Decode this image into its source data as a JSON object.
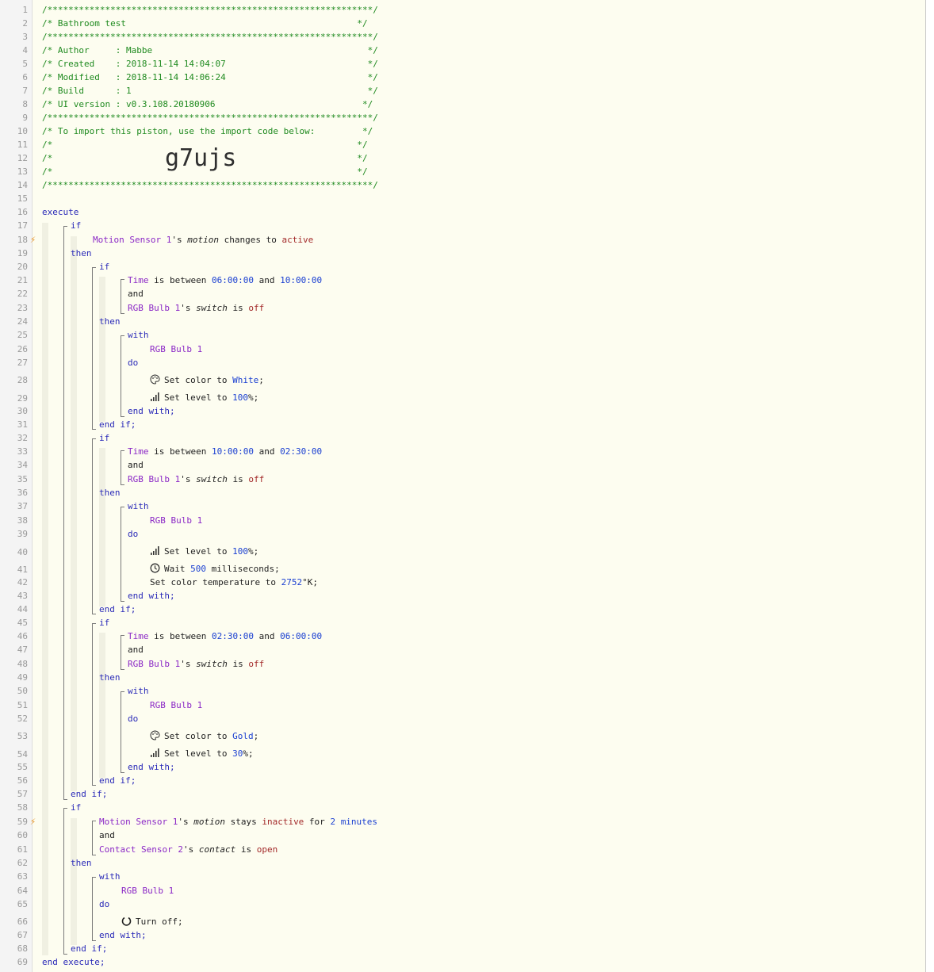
{
  "header": {
    "rule": "/**************************************************************/",
    "title_line": "/* Bathroom test                                            */",
    "author": "/* Author     : Mabbe                                         */",
    "created": "/* Created    : 2018-11-14 14:04:07                           */",
    "modified": "/* Modified   : 2018-11-14 14:06:24                           */",
    "build": "/* Build      : 1                                             */",
    "ui_version": "/* UI version : v0.3.108.20180906                            */",
    "import_note": "/* To import this piston, use the import code below:         */",
    "blank_open": "/*                                                          */",
    "import_code": "g7ujs"
  },
  "keywords": {
    "execute": "execute",
    "end_execute": "end execute;",
    "if": "if",
    "then": "then",
    "and": "and",
    "with": "with",
    "do": "do",
    "end_with": "end with;",
    "end_if": "end if;",
    "is_between": " is between ",
    "and_inline": " and ",
    "s_switch": "'s ",
    "is": " is ",
    "changes_to": " changes to ",
    "stays": " stays ",
    "for": " for "
  },
  "devices": {
    "motion1": "Motion Sensor 1",
    "bulb1": "RGB Bulb 1",
    "contact2": "Contact Sensor 2",
    "time": "Time"
  },
  "attrs": {
    "motion": "motion",
    "switch": "switch",
    "contact": "contact"
  },
  "states": {
    "active": "active",
    "off": "off",
    "inactive": "inactive",
    "open": "open"
  },
  "times": {
    "t0600": "06:00:00",
    "t1000": "10:00:00",
    "t0230": "02:30:00"
  },
  "actions": {
    "set_color_white_pre": "Set color to ",
    "white": "White",
    "gold": "Gold",
    "set_level_pre": "Set level to ",
    "lvl100": "100",
    "lvl30": "30",
    "pct": "%;",
    "semi": ";",
    "wait_pre": "Wait ",
    "wait_ms": "500",
    "wait_post": " milliseconds;",
    "ct_pre": "Set color temperature to ",
    "ct_val": "2752",
    "ct_post": "°K;",
    "turn_off": "Turn off;"
  },
  "misc": {
    "two": "2",
    "minutes": "minutes"
  },
  "line_numbers": [
    "1",
    "2",
    "3",
    "4",
    "5",
    "6",
    "7",
    "8",
    "9",
    "10",
    "11",
    "12",
    "13",
    "14",
    "15",
    "16",
    "17",
    "18",
    "19",
    "20",
    "21",
    "22",
    "23",
    "24",
    "25",
    "26",
    "27",
    "28",
    "29",
    "30",
    "31",
    "32",
    "33",
    "34",
    "35",
    "36",
    "37",
    "38",
    "39",
    "40",
    "41",
    "42",
    "43",
    "44",
    "45",
    "46",
    "47",
    "48",
    "49",
    "50",
    "51",
    "52",
    "53",
    "54",
    "55",
    "56",
    "57",
    "58",
    "59",
    "60",
    "61",
    "62",
    "63",
    "64",
    "65",
    "66",
    "67",
    "68",
    "69"
  ],
  "colors": {
    "comment": "#1f8a1f",
    "keyword": "#2a2ab8",
    "device": "#8b28c6",
    "value": "#1a3fd1",
    "state": "#a32a2a"
  }
}
